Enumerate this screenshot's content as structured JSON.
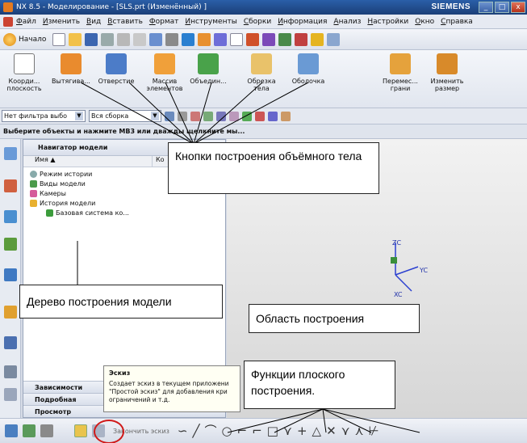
{
  "window": {
    "title": "NX 8.5 - Моделирование - [SLS.prt (Изменённый) ]",
    "brand": "SIEMENS",
    "buttons": [
      "_",
      "□",
      "x"
    ]
  },
  "menu": [
    "Файл",
    "Изменить",
    "Вид",
    "Вставить",
    "Формат",
    "Инструменты",
    "Сборки",
    "Информация",
    "Анализ",
    "Настройки",
    "Окно",
    "Справка"
  ],
  "toolbar": {
    "start_label": "Начало"
  },
  "ribbon": {
    "items": [
      "Коорди...\nплоскость",
      "Вытягива...",
      "Отверстие",
      "Массив\nэлементов",
      "Объедин...",
      "Обрезка\nтела",
      "Оболочка",
      "Перемес...\nграни",
      "Изменить\nразмер"
    ]
  },
  "filterbar": {
    "filter_value": "Нет фильтра выбо",
    "assembly_value": "Вся сборка"
  },
  "status_text": "Выберите объекты и нажмите MB3 или дважды щелкните мы...",
  "navigator": {
    "title": "Навигатор модели",
    "col_name": "Имя",
    "col_second": "Ко",
    "rows": [
      "Режим истории",
      "Виды модели",
      "Камеры",
      "История модели",
      "Базовая система ко..."
    ],
    "bottom": [
      "Зависимости",
      "Подробная",
      "Просмотр"
    ]
  },
  "viewport": {
    "axis_z": "ZC",
    "axis_y": "YC",
    "axis_x": "XC"
  },
  "tooltip": {
    "title": "Эскиз",
    "text": "Создает эскиз в текущем приложени \"Простой эскиз\" для добавления кри ограничений и т.д."
  },
  "bottom": {
    "finish_sketch": "Закончить эскиз"
  },
  "callouts": {
    "body": "Кнопки построения объёмного тела",
    "tree": "Дерево построения модели",
    "area": "Область построения",
    "flat": "Функции плоского построения."
  },
  "colors": {
    "accent": "#d01a1a",
    "title_bg": "#1b3f78"
  }
}
